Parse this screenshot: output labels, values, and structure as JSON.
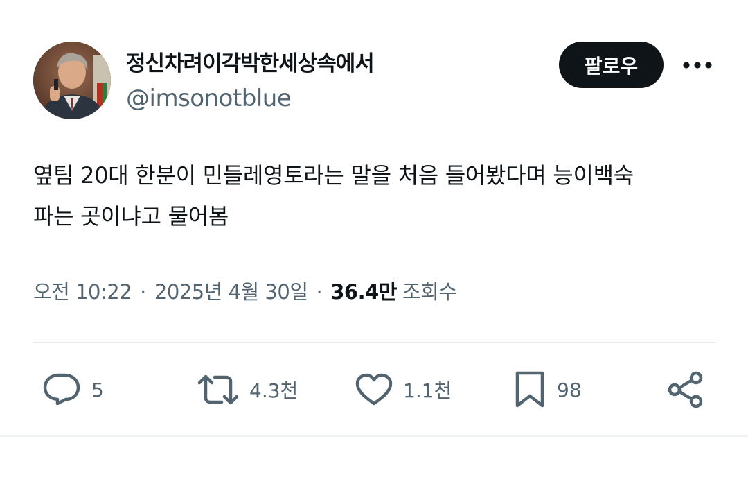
{
  "user": {
    "display_name": "정신차려이각박한세상속에서",
    "handle": "@imsonotblue",
    "avatar": "avatar-photo"
  },
  "follow_label": "팔로우",
  "tweet": {
    "lines": [
      "옆팀 20대 한분이 민들레영토라는 말을 처음 들어봤다며 능이백숙",
      "파는 곳이냐고 물어봄"
    ]
  },
  "meta": {
    "time": "오전 10:22",
    "separator": "·",
    "date": "2025년 4월 30일",
    "views_count": "36.4만",
    "views_label": "조회수"
  },
  "actions": {
    "reply": {
      "icon": "reply-icon",
      "count": "5"
    },
    "retweet": {
      "icon": "retweet-icon",
      "count": "4.3천"
    },
    "like": {
      "icon": "heart-icon",
      "count": "1.1천"
    },
    "bookmark": {
      "icon": "bookmark-icon",
      "count": "98"
    },
    "share": {
      "icon": "share-icon"
    }
  },
  "colors": {
    "text": "#0f1419",
    "secondary": "#536471",
    "button_bg": "#0f1419",
    "button_text": "#ffffff",
    "divider": "#e6ecf0"
  }
}
